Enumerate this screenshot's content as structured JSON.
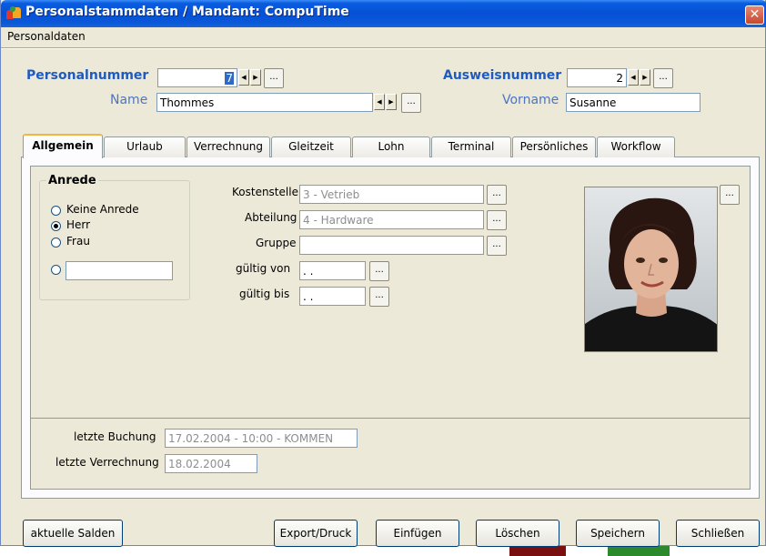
{
  "window": {
    "title": "Personalstammdaten / Mandant: CompuTime",
    "close_symbol": "✕"
  },
  "menu": {
    "personaldaten": "Personaldaten"
  },
  "header": {
    "personalnummer_label": "Personalnummer",
    "personalnummer_value": "7",
    "ausweisnummer_label": "Ausweisnummer",
    "ausweisnummer_value": "2",
    "name_label": "Name",
    "name_value": "Thommes",
    "vorname_label": "Vorname",
    "vorname_value": "Susanne",
    "dots": "..."
  },
  "tabs": [
    {
      "label": "Allgemein"
    },
    {
      "label": "Urlaub"
    },
    {
      "label": "Verrechnung"
    },
    {
      "label": "Gleitzeit"
    },
    {
      "label": "Lohn"
    },
    {
      "label": "Terminal"
    },
    {
      "label": "Persönliches"
    },
    {
      "label": "Workflow"
    }
  ],
  "anrede": {
    "title": "Anrede",
    "options": [
      "Keine Anrede",
      "Herr",
      "Frau"
    ],
    "selected": "Herr",
    "custom_value": ""
  },
  "fields": {
    "kostenstelle_label": "Kostenstelle",
    "kostenstelle_value": "3 - Vetrieb",
    "abteilung_label": "Abteilung",
    "abteilung_value": "4 - Hardware",
    "gruppe_label": "Gruppe",
    "gruppe_value": "",
    "gueltig_von_label": "gültig von",
    "gueltig_von_value": " .  .",
    "gueltig_bis_label": "gültig bis",
    "gueltig_bis_value": " .  ."
  },
  "footer_info": {
    "letzte_buchung_label": "letzte Buchung",
    "letzte_buchung_value": "17.02.2004 - 10:00 - KOMMEN",
    "letzte_verrechnung_label": "letzte Verrechnung",
    "letzte_verrechnung_value": "18.02.2004"
  },
  "buttons": {
    "aktuelle_salden": "aktuelle Salden",
    "export_druck": "Export/Druck",
    "einfuegen": "Einfügen",
    "loeschen": "Löschen",
    "speichern": "Speichern",
    "schliessen": "Schließen"
  },
  "colors": {
    "title_blue": "#0650d6",
    "label_blue": "#1f5bbf",
    "tab_highlight": "#f1b63f"
  }
}
